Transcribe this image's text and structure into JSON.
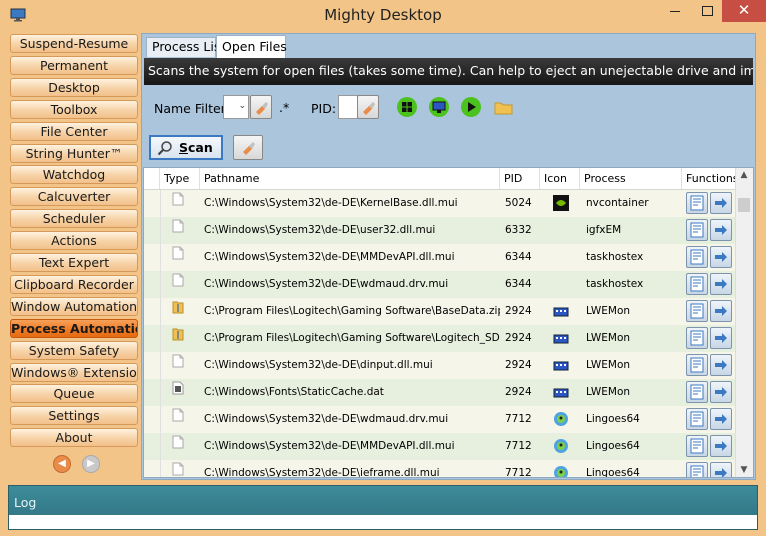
{
  "window": {
    "title": "Mighty Desktop"
  },
  "nav": {
    "items": [
      {
        "label": "Suspend-Resume"
      },
      {
        "label": "Permanent"
      },
      {
        "label": "Desktop"
      },
      {
        "label": "Toolbox"
      },
      {
        "label": "File Center"
      },
      {
        "label": "String Hunter™"
      },
      {
        "label": "Watchdog"
      },
      {
        "label": "Calcuverter"
      },
      {
        "label": "Scheduler"
      },
      {
        "label": "Actions"
      },
      {
        "label": "Text Expert"
      },
      {
        "label": "Clipboard Recorder"
      },
      {
        "label": "Window Automation"
      },
      {
        "label": "Process Automation",
        "active": true
      },
      {
        "label": "System Safety"
      },
      {
        "label": "Windows® Extensions"
      },
      {
        "label": "Queue"
      },
      {
        "label": "Settings"
      },
      {
        "label": "About"
      }
    ]
  },
  "tabs": {
    "process_list": "Process List",
    "open_files": "Open Files"
  },
  "banner": "Scans the system for open files (takes some time). Can help to eject an unejectable drive and improve safety.",
  "filters": {
    "name_label": "Name Filter:",
    "name_suffix": ".*",
    "pid_label": "PID:"
  },
  "toolbar_icons": [
    "windows-logo-icon",
    "monitor-icon",
    "play-icon",
    "folder-icon"
  ],
  "scan": {
    "label_underlined": "S",
    "label_rest": "can"
  },
  "grid": {
    "columns": [
      "Type",
      "Pathname",
      "PID",
      "Icon",
      "Process",
      "Functions"
    ],
    "rows": [
      {
        "type": "file",
        "path": "C:\\Windows\\System32\\de-DE\\KernelBase.dll.mui",
        "pid": "5024",
        "icon": "nvidia-icon",
        "process": "nvcontainer"
      },
      {
        "type": "file",
        "path": "C:\\Windows\\System32\\de-DE\\user32.dll.mui",
        "pid": "6332",
        "icon": "",
        "process": "igfxEM"
      },
      {
        "type": "file",
        "path": "C:\\Windows\\System32\\de-DE\\MMDevAPI.dll.mui",
        "pid": "6344",
        "icon": "",
        "process": "taskhostex"
      },
      {
        "type": "file",
        "path": "C:\\Windows\\System32\\de-DE\\wdmaud.drv.mui",
        "pid": "6344",
        "icon": "",
        "process": "taskhostex"
      },
      {
        "type": "zip",
        "path": "C:\\Program Files\\Logitech\\Gaming Software\\BaseData.zip",
        "pid": "2924",
        "icon": "keyboard-icon",
        "process": "LWEMon"
      },
      {
        "type": "zip",
        "path": "C:\\Program Files\\Logitech\\Gaming Software\\Logitech_SDK_For_PC_",
        "pid": "2924",
        "icon": "keyboard-icon",
        "process": "LWEMon"
      },
      {
        "type": "file",
        "path": "C:\\Windows\\System32\\de-DE\\dinput.dll.mui",
        "pid": "2924",
        "icon": "keyboard-icon",
        "process": "LWEMon"
      },
      {
        "type": "dat",
        "path": "C:\\Windows\\Fonts\\StaticCache.dat",
        "pid": "2924",
        "icon": "keyboard-icon",
        "process": "LWEMon"
      },
      {
        "type": "file",
        "path": "C:\\Windows\\System32\\de-DE\\wdmaud.drv.mui",
        "pid": "7712",
        "icon": "lingoes-icon",
        "process": "Lingoes64"
      },
      {
        "type": "file",
        "path": "C:\\Windows\\System32\\de-DE\\MMDevAPI.dll.mui",
        "pid": "7712",
        "icon": "lingoes-icon",
        "process": "Lingoes64"
      },
      {
        "type": "file",
        "path": "C:\\Windows\\System32\\de-DE\\ieframe.dll.mui",
        "pid": "7712",
        "icon": "lingoes-icon",
        "process": "Lingoes64"
      }
    ]
  },
  "log": {
    "label": "Log"
  },
  "colors": {
    "active_nav": "#ee7a22",
    "panel": "#abc5dd",
    "log": "#3d8c9a"
  }
}
